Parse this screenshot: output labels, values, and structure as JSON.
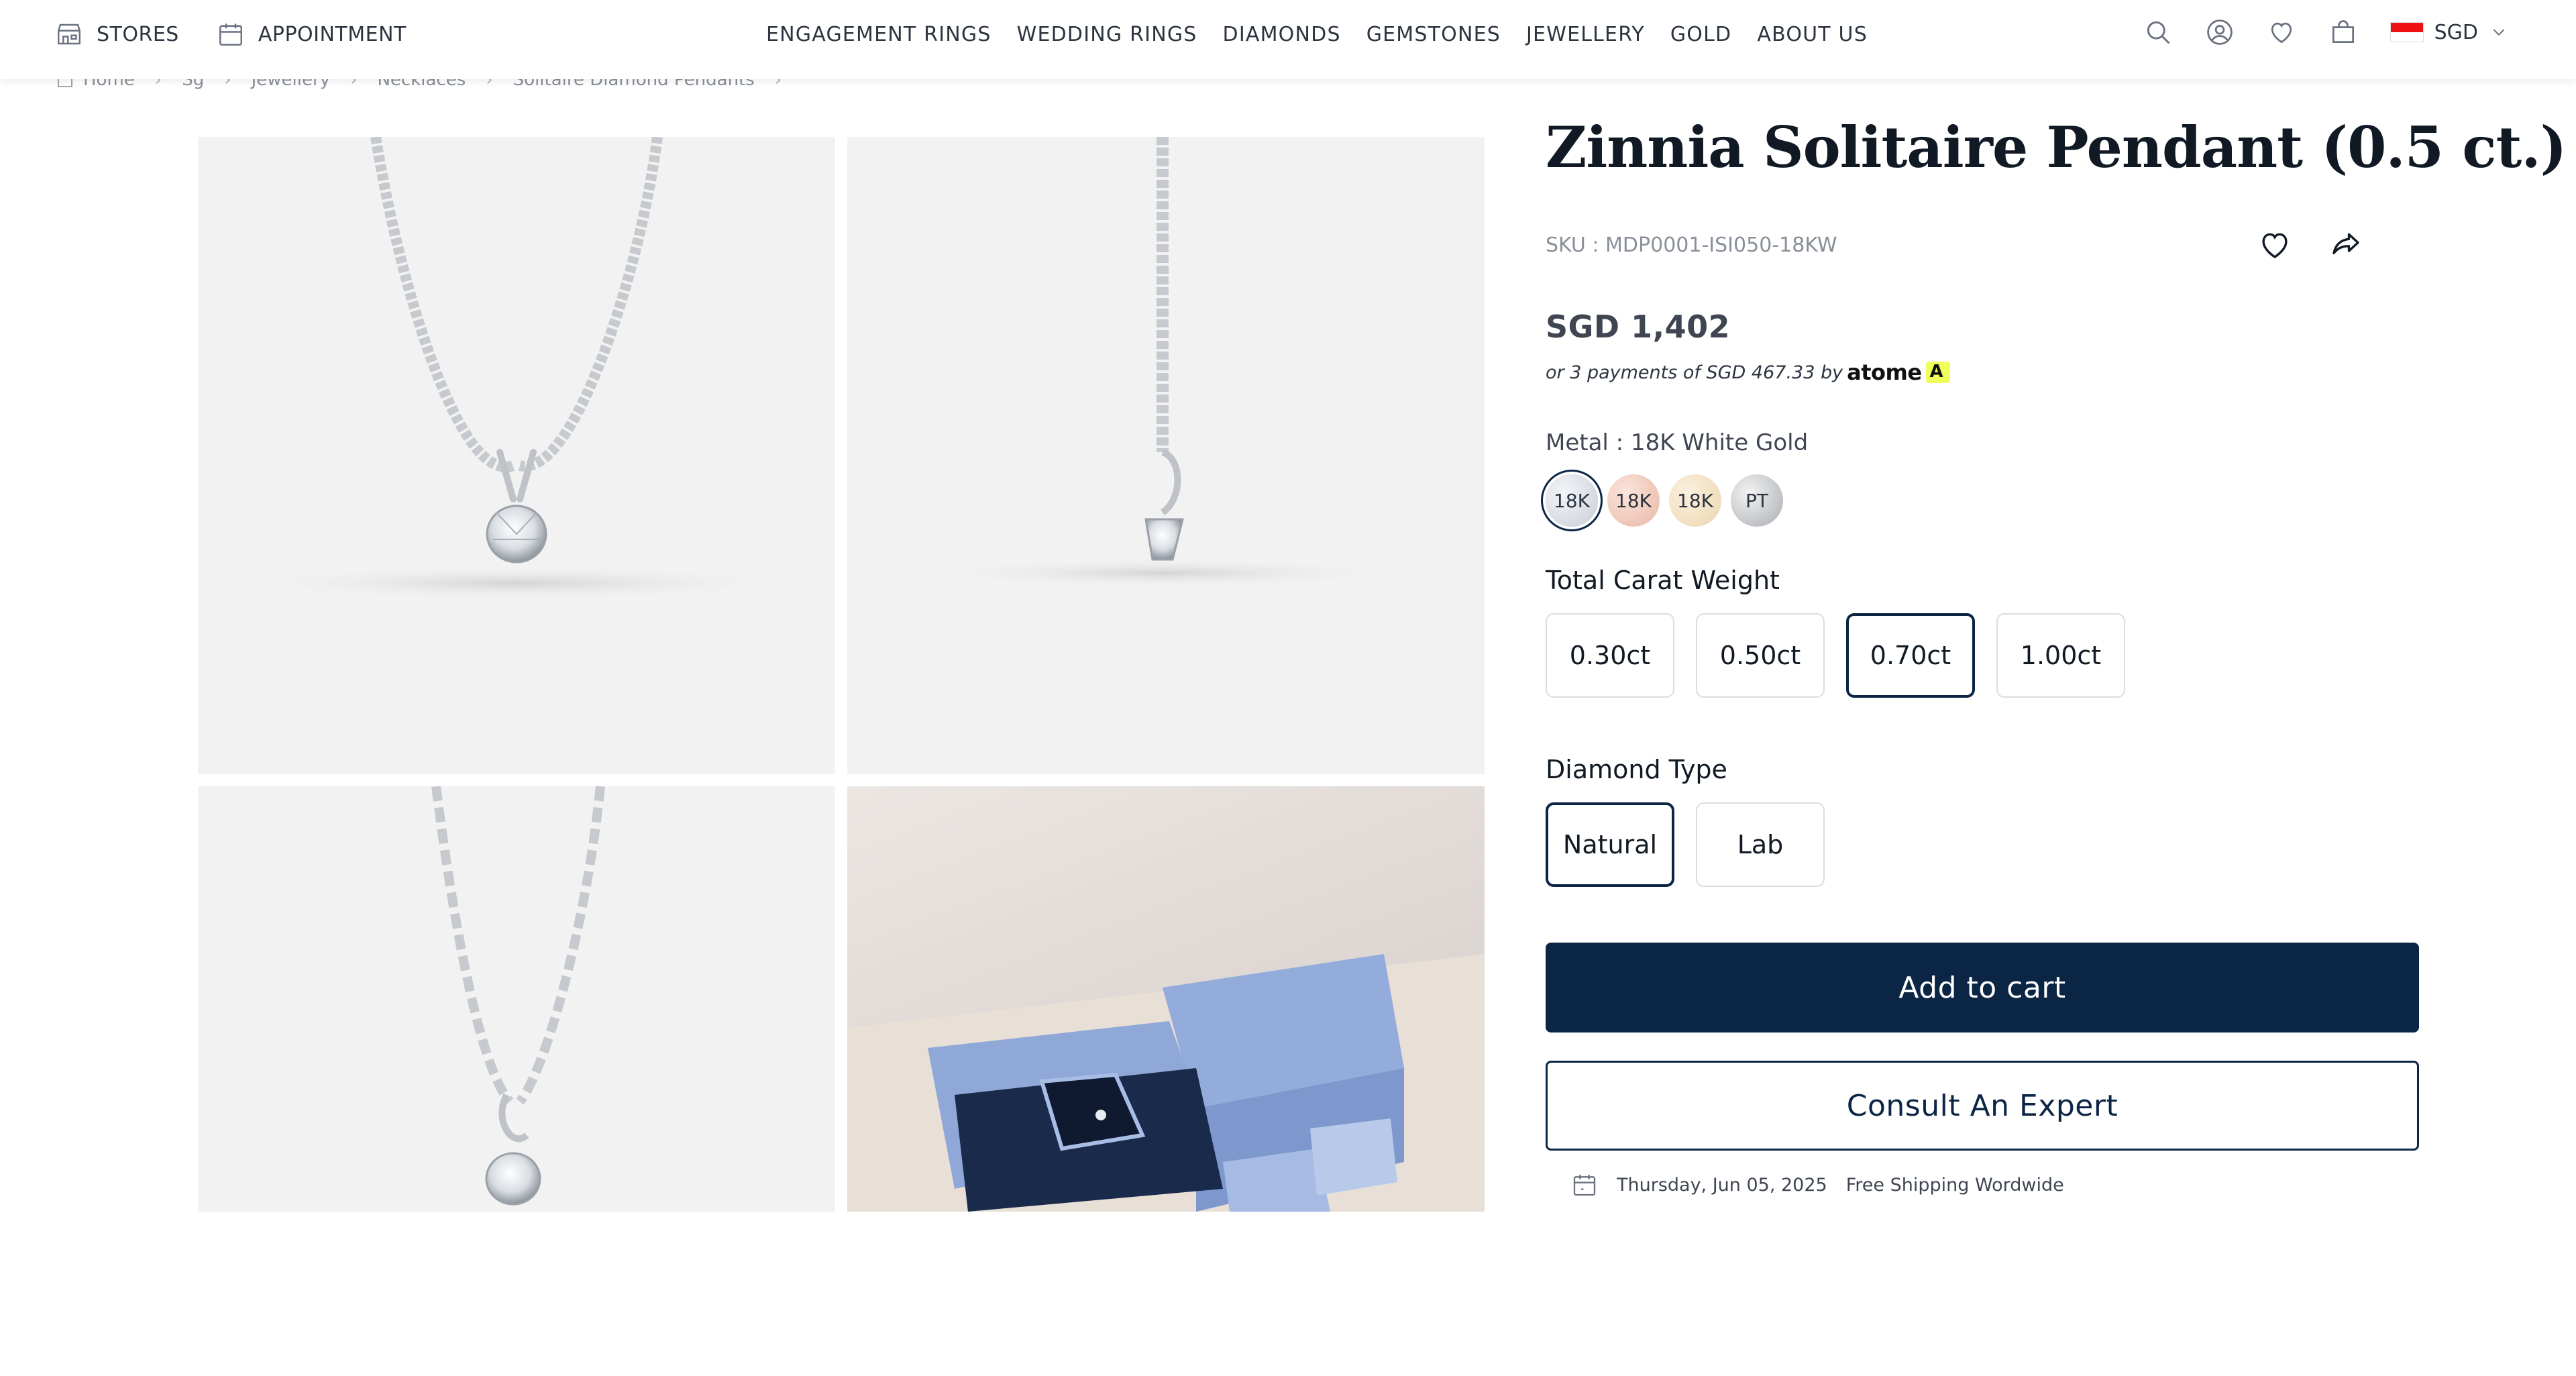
{
  "header": {
    "stores_label": "STORES",
    "appointment_label": "APPOINTMENT",
    "nav": [
      "ENGAGEMENT RINGS",
      "WEDDING RINGS",
      "DIAMONDS",
      "GEMSTONES",
      "JEWELLERY",
      "GOLD",
      "ABOUT US"
    ],
    "currency": "SGD",
    "icons": [
      "search-icon",
      "account-icon",
      "wishlist-icon",
      "bag-icon",
      "singapore-flag-icon",
      "chevron-down-icon"
    ]
  },
  "breadcrumb": [
    "Home",
    "Sg",
    "Jewellery",
    "Necklaces",
    "Solitaire Diamond Pendants"
  ],
  "product": {
    "title": "Zinnia Solitaire Pendant (0.5 ct.)",
    "sku": "SKU : MDP0001-ISI050-18KW",
    "price": "SGD 1,402",
    "installment_text": "or 3 payments of SGD 467.33 by",
    "installment_provider": "atome",
    "installment_badge": "A",
    "metal_label": "Metal : 18K White Gold",
    "metals": [
      {
        "label": "18K",
        "selected": true
      },
      {
        "label": "18K",
        "selected": false
      },
      {
        "label": "18K",
        "selected": false
      },
      {
        "label": "PT",
        "selected": false
      }
    ],
    "carat_label": "Total Carat Weight",
    "carats": [
      {
        "label": "0.30ct",
        "selected": false
      },
      {
        "label": "0.50ct",
        "selected": false
      },
      {
        "label": "0.70ct",
        "selected": true
      },
      {
        "label": "1.00ct",
        "selected": false
      }
    ],
    "diamond_type_label": "Diamond Type",
    "diamond_types": [
      {
        "label": "Natural",
        "selected": true
      },
      {
        "label": "Lab",
        "selected": false
      }
    ],
    "add_to_cart": "Add to cart",
    "consult": "Consult An Expert",
    "delivery_date": "Thursday, Jun 05, 2025",
    "shipping_note": "Free Shipping Wordwide"
  },
  "colors": {
    "navy": "#0b2545",
    "text": "#1c2733",
    "muted": "#8a9099",
    "tile_bg": "#f2f2f2",
    "box_blue": "#8fa8d8"
  }
}
